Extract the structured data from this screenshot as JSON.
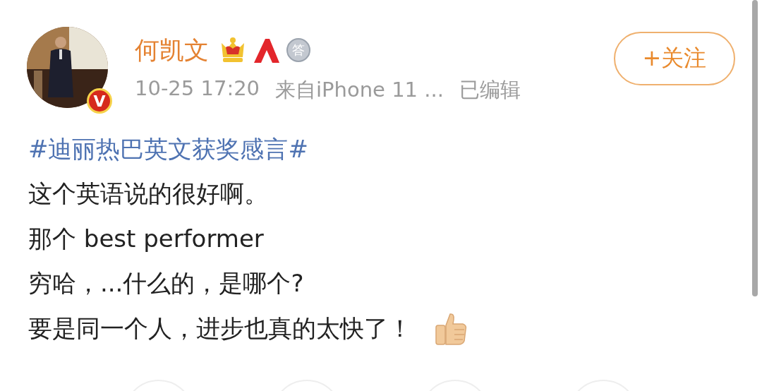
{
  "post": {
    "author": {
      "name": "何凯文",
      "verified": true,
      "verified_mark": "V",
      "badges": [
        {
          "kind": "crown"
        },
        {
          "kind": "mountain"
        },
        {
          "kind": "medal",
          "text": "答"
        }
      ]
    },
    "time": "10-25 17:20",
    "source": "来自iPhone 11 ...",
    "edited": "已编辑",
    "follow_button": "+关注",
    "lines": [
      {
        "kind": "hashtag",
        "text": "#迪丽热巴英文获奖感言#"
      },
      {
        "kind": "text",
        "text": "这个英语说的很好啊。"
      },
      {
        "kind": "text",
        "text": "那个 best performer"
      },
      {
        "kind": "text",
        "text": "穷哈，...什么的，是哪个?"
      },
      {
        "kind": "text",
        "text": "要是同一个人，进步也真的太快了！",
        "emoji": {
          "kind": "thumbs_up"
        }
      }
    ]
  }
}
